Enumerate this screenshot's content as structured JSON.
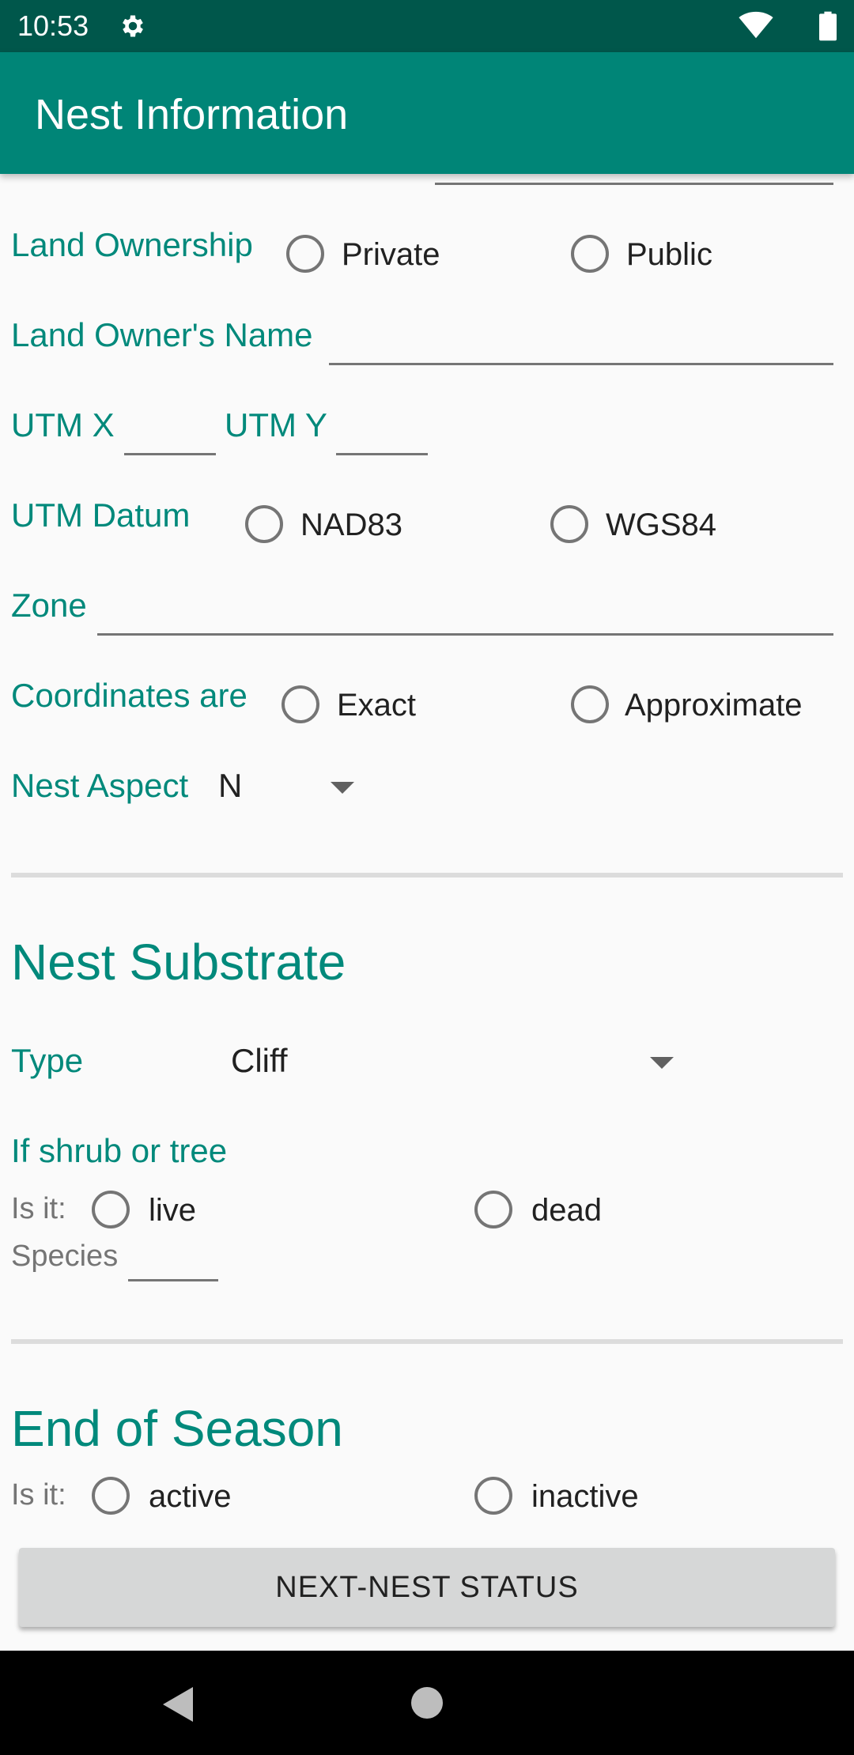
{
  "status_bar": {
    "time": "10:53",
    "icons": [
      "gear-icon",
      "wifi-icon",
      "battery-icon"
    ]
  },
  "app_bar": {
    "title": "Nest Information"
  },
  "colors": {
    "primary": "#008577",
    "primary_dark": "#00574b",
    "accent_text": "#00897b"
  },
  "form": {
    "land_ownership": {
      "label": "Land Ownership",
      "options": [
        "Private",
        "Public"
      ]
    },
    "land_owner_name": {
      "label": "Land Owner's Name",
      "value": ""
    },
    "utm_x": {
      "label": "UTM X",
      "value": ""
    },
    "utm_y": {
      "label": "UTM Y",
      "value": ""
    },
    "utm_datum": {
      "label": "UTM Datum",
      "options": [
        "NAD83",
        "WGS84"
      ]
    },
    "zone": {
      "label": "Zone",
      "value": ""
    },
    "coordinates": {
      "label": "Coordinates are",
      "options": [
        "Exact",
        "Approximate"
      ]
    },
    "nest_aspect": {
      "label": "Nest Aspect",
      "value": "N"
    }
  },
  "nest_substrate": {
    "heading": "Nest Substrate",
    "type_label": "Type",
    "type_value": "Cliff",
    "shrub_tree_label": "If shrub or tree",
    "is_it_label": "Is it:",
    "options": [
      "live",
      "dead"
    ],
    "species_label": "Species",
    "species_value": ""
  },
  "end_of_season": {
    "heading": "End of Season",
    "is_it_label": "Is it:",
    "options": [
      "active",
      "inactive"
    ]
  },
  "next_button": {
    "label": "NEXT-NEST STATUS"
  }
}
